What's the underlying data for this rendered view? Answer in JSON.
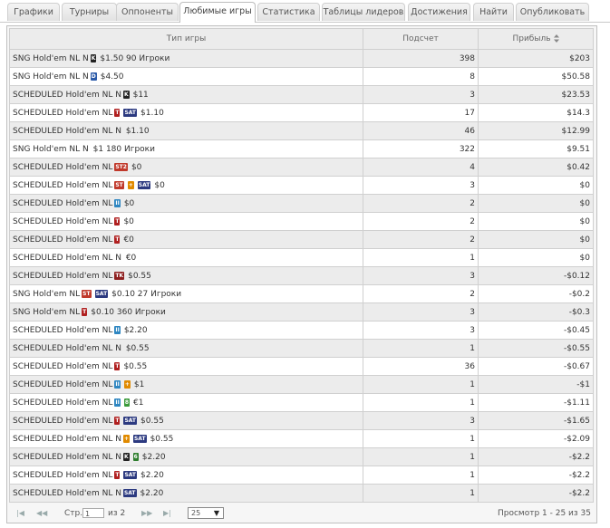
{
  "tabs": [
    {
      "label": "Графики",
      "active": false
    },
    {
      "label": "Турниры",
      "active": false
    },
    {
      "label": "Оппоненты",
      "active": false
    },
    {
      "label": "Любимые игры",
      "active": true
    },
    {
      "label": "Статистика",
      "active": false
    },
    {
      "label": "Таблицы лидеров",
      "active": false
    },
    {
      "label": "Достижения",
      "active": false
    },
    {
      "label": "Найти",
      "active": false
    },
    {
      "label": "Опубликовать",
      "active": false
    }
  ],
  "table": {
    "headers": {
      "game_type": "Тип игры",
      "count": "Подсчет",
      "profit": "Прибыль"
    },
    "rows": [
      {
        "prefix": "SNG Hold'em NL N",
        "badges": [
          {
            "text": "K",
            "cls": "b-k"
          }
        ],
        "suffix": "$1.50 90 Игроки",
        "count": "398",
        "profit": "$203"
      },
      {
        "prefix": "SNG Hold'em NL N",
        "badges": [
          {
            "text": "D",
            "cls": "b-d"
          }
        ],
        "suffix": "$4.50",
        "count": "8",
        "profit": "$50.58"
      },
      {
        "prefix": "SCHEDULED Hold'em NL N",
        "badges": [
          {
            "text": "K",
            "cls": "b-k"
          }
        ],
        "suffix": "$11",
        "count": "3",
        "profit": "$23.53"
      },
      {
        "prefix": "SCHEDULED Hold'em NL",
        "badges": [
          {
            "text": "T",
            "cls": "b-t"
          },
          {
            "text": "SAT",
            "cls": "b-sat"
          }
        ],
        "suffix": "$1.10",
        "count": "17",
        "profit": "$14.3"
      },
      {
        "prefix": "SCHEDULED Hold'em NL N",
        "badges": [],
        "suffix": "$1.10",
        "count": "46",
        "profit": "$12.99"
      },
      {
        "prefix": "SNG Hold'em NL N",
        "badges": [],
        "suffix": "$1 180 Игроки",
        "count": "322",
        "profit": "$9.51"
      },
      {
        "prefix": "SCHEDULED Hold'em NL",
        "badges": [
          {
            "text": "ST2",
            "cls": "b-st2"
          }
        ],
        "suffix": "$0",
        "count": "4",
        "profit": "$0.42"
      },
      {
        "prefix": "SCHEDULED Hold'em NL",
        "badges": [
          {
            "text": "ST",
            "cls": "b-st2"
          },
          {
            "text": "+",
            "cls": "b-plus"
          },
          {
            "text": "SAT",
            "cls": "b-sat"
          }
        ],
        "suffix": "$0",
        "count": "3",
        "profit": "$0"
      },
      {
        "prefix": "SCHEDULED Hold'em NL",
        "badges": [
          {
            "text": "II",
            "cls": "b-ii"
          }
        ],
        "suffix": "$0",
        "count": "2",
        "profit": "$0"
      },
      {
        "prefix": "SCHEDULED Hold'em NL",
        "badges": [
          {
            "text": "T",
            "cls": "b-t"
          }
        ],
        "suffix": "$0",
        "count": "2",
        "profit": "$0"
      },
      {
        "prefix": "SCHEDULED Hold'em NL",
        "badges": [
          {
            "text": "T",
            "cls": "b-t"
          }
        ],
        "suffix": "€0",
        "count": "2",
        "profit": "$0"
      },
      {
        "prefix": "SCHEDULED Hold'em NL N",
        "badges": [],
        "suffix": "€0",
        "count": "1",
        "profit": "$0"
      },
      {
        "prefix": "SCHEDULED Hold'em NL",
        "badges": [
          {
            "text": "TK",
            "cls": "b-tk"
          }
        ],
        "suffix": "$0.55",
        "count": "3",
        "profit": "-$0.12"
      },
      {
        "prefix": "SNG Hold'em NL",
        "badges": [
          {
            "text": "ST",
            "cls": "b-st2"
          },
          {
            "text": "SAT",
            "cls": "b-sat"
          }
        ],
        "suffix": "$0.10 27 Игроки",
        "count": "2",
        "profit": "-$0.2"
      },
      {
        "prefix": "SNG Hold'em NL",
        "badges": [
          {
            "text": "T",
            "cls": "b-t"
          }
        ],
        "suffix": "$0.10 360 Игроки",
        "count": "3",
        "profit": "-$0.3"
      },
      {
        "prefix": "SCHEDULED Hold'em NL",
        "badges": [
          {
            "text": "II",
            "cls": "b-ii"
          }
        ],
        "suffix": "$2.20",
        "count": "3",
        "profit": "-$0.45"
      },
      {
        "prefix": "SCHEDULED Hold'em NL N",
        "badges": [],
        "suffix": "$0.55",
        "count": "1",
        "profit": "-$0.55"
      },
      {
        "prefix": "SCHEDULED Hold'em NL",
        "badges": [
          {
            "text": "T",
            "cls": "b-t"
          }
        ],
        "suffix": "$0.55",
        "count": "36",
        "profit": "-$0.67"
      },
      {
        "prefix": "SCHEDULED Hold'em NL",
        "badges": [
          {
            "text": "II",
            "cls": "b-ii"
          },
          {
            "text": "+",
            "cls": "b-plus"
          }
        ],
        "suffix": "$1",
        "count": "1",
        "profit": "-$1"
      },
      {
        "prefix": "SCHEDULED Hold'em NL",
        "badges": [
          {
            "text": "II",
            "cls": "b-ii"
          },
          {
            "text": "8",
            "cls": "b-8"
          }
        ],
        "suffix": "€1",
        "count": "1",
        "profit": "-$1.11"
      },
      {
        "prefix": "SCHEDULED Hold'em NL",
        "badges": [
          {
            "text": "T",
            "cls": "b-t"
          },
          {
            "text": "SAT",
            "cls": "b-sat"
          }
        ],
        "suffix": "$0.55",
        "count": "3",
        "profit": "-$1.65"
      },
      {
        "prefix": "SCHEDULED Hold'em NL N",
        "badges": [
          {
            "text": "+",
            "cls": "b-plus"
          },
          {
            "text": "SAT",
            "cls": "b-sat"
          }
        ],
        "suffix": "$0.55",
        "count": "1",
        "profit": "-$2.09"
      },
      {
        "prefix": "SCHEDULED Hold'em NL N",
        "badges": [
          {
            "text": "K",
            "cls": "b-k"
          },
          {
            "text": "6",
            "cls": "b-k6"
          }
        ],
        "suffix": "$2.20",
        "count": "1",
        "profit": "-$2.2"
      },
      {
        "prefix": "SCHEDULED Hold'em NL",
        "badges": [
          {
            "text": "T",
            "cls": "b-t"
          },
          {
            "text": "SAT",
            "cls": "b-sat"
          }
        ],
        "suffix": "$2.20",
        "count": "1",
        "profit": "-$2.2"
      },
      {
        "prefix": "SCHEDULED Hold'em NL N",
        "badges": [
          {
            "text": "SAT",
            "cls": "b-sat"
          }
        ],
        "suffix": "$2.20",
        "count": "1",
        "profit": "-$2.2"
      }
    ]
  },
  "pager": {
    "page_label": "Стр.",
    "page_value": "1",
    "of_label": "из 2",
    "page_size": "25",
    "summary": "Просмотр 1 - 25 из 35"
  },
  "icons": {
    "first": "first-page-icon",
    "prev": "prev-page-icon",
    "next": "next-page-icon",
    "last": "last-page-icon",
    "sort": "sort-icon"
  }
}
